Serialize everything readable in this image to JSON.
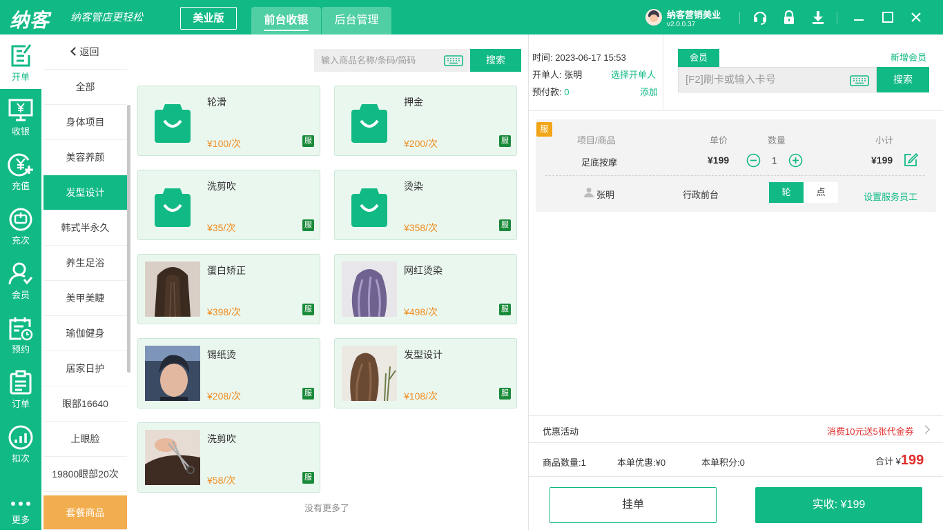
{
  "header": {
    "logo": "纳客",
    "slogan": "纳客管店更轻松",
    "edition": "美业版",
    "tabs": [
      {
        "label": "前台收银",
        "active": true
      },
      {
        "label": "后台管理",
        "active": false
      }
    ],
    "user_name": "纳客营销美业",
    "version": "v2.0.0.37",
    "icons": [
      "headset-icon",
      "lock-icon",
      "download-icon",
      "minimize-icon",
      "maximize-icon",
      "close-icon"
    ],
    "accent_color": "#11b985"
  },
  "sidebar": {
    "items": [
      {
        "label": "开单",
        "icon": "order-form-icon",
        "active": true
      },
      {
        "label": "收银",
        "icon": "cashier-icon"
      },
      {
        "label": "充值",
        "icon": "recharge-icon"
      },
      {
        "label": "充次",
        "icon": "recharge-times-icon"
      },
      {
        "label": "会员",
        "icon": "member-icon"
      },
      {
        "label": "预约",
        "icon": "appointment-icon"
      },
      {
        "label": "订单",
        "icon": "orders-icon"
      },
      {
        "label": "扣次",
        "icon": "deduct-times-icon"
      },
      {
        "label": "更多",
        "icon": "more-icon"
      }
    ]
  },
  "categories": {
    "back": "返回",
    "items": [
      "全部",
      "身体项目",
      "美容养颜",
      "发型设计",
      "韩式半永久",
      "养生足浴",
      "美甲美睫",
      "瑜伽健身",
      "居家日护",
      "眼部16640",
      "上眼脸",
      "19800眼部20次"
    ],
    "active": "发型设计",
    "combo": "套餐商品"
  },
  "search": {
    "placeholder": "输入商品名称/条码/简码",
    "button": "搜索"
  },
  "products": [
    {
      "name": "轮滑",
      "price": "¥100/次",
      "badge": "服",
      "image": "bag"
    },
    {
      "name": "押金",
      "price": "¥200/次",
      "badge": "服",
      "image": "bag"
    },
    {
      "name": "洗剪吹",
      "price": "¥35/次",
      "badge": "服",
      "image": "bag"
    },
    {
      "name": "烫染",
      "price": "¥358/次",
      "badge": "服",
      "image": "bag"
    },
    {
      "name": "蛋白矫正",
      "price": "¥398/次",
      "badge": "服",
      "image": "straight-hair"
    },
    {
      "name": "网红烫染",
      "price": "¥498/次",
      "badge": "服",
      "image": "purple-hair"
    },
    {
      "name": "锡纸烫",
      "price": "¥208/次",
      "badge": "服",
      "image": "man-portrait"
    },
    {
      "name": "发型设计",
      "price": "¥108/次",
      "badge": "服",
      "image": "long-hair"
    },
    {
      "name": "洗剪吹",
      "price": "¥58/次",
      "badge": "服",
      "image": "scissors-cut"
    }
  ],
  "no_more": "没有更多了",
  "order_info": {
    "time_label": "时间:",
    "time": "2023-06-17 15:53",
    "operator_label": "开单人:",
    "operator": "张明",
    "select_operator": "选择开单人",
    "prepaid_label": "预付款:",
    "prepaid": "0",
    "add": "添加"
  },
  "member": {
    "tab": "会员",
    "new_member": "新增会员",
    "placeholder": "[F2]刷卡或输入卡号",
    "button": "搜索"
  },
  "order": {
    "badge": "服",
    "headers": {
      "item": "项目/商品",
      "price": "单价",
      "qty": "数量",
      "subtotal": "小计"
    },
    "item": {
      "name": "足底按摩",
      "price": "¥199",
      "qty": "1",
      "subtotal": "¥199"
    },
    "staff": "张明",
    "role": "行政前台",
    "mode_rotate": "轮",
    "mode_point": "点",
    "set_staff": "设置服务员工"
  },
  "promo": {
    "label": "优惠活动",
    "value": "消费10元送5张代金券"
  },
  "summary": {
    "count_label": "商品数量:",
    "count": "1",
    "discount_label": "本单优惠:",
    "discount": "¥0",
    "points_label": "本单积分:",
    "points": "0",
    "total_label": "合计 ¥",
    "total": "199"
  },
  "actions": {
    "hang": "挂单",
    "pay": "实收: ¥199"
  }
}
